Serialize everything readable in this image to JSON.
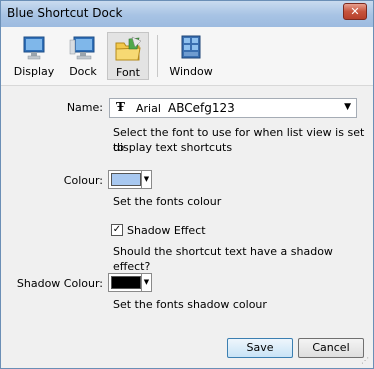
{
  "window": {
    "title": "Blue Shortcut Dock",
    "close_label": "✕"
  },
  "toolbar": {
    "items": [
      {
        "label": "Display",
        "icon": "monitor-icon"
      },
      {
        "label": "Dock",
        "icon": "monitor-dock-icon"
      },
      {
        "label": "Font",
        "icon": "folder-font-icon",
        "active": true
      },
      {
        "label": "Window",
        "icon": "window-grid-icon"
      }
    ]
  },
  "name": {
    "label": "Name:",
    "font_icon": "Ŧ",
    "font_name": "Arial",
    "sample": "ABCefg123",
    "description_line1": "Select the font to use for when list view is set to",
    "description_line2": "display text shortcuts"
  },
  "colour": {
    "label": "Colour:",
    "swatch_color": "#a8c8f0",
    "description": "Set the fonts colour"
  },
  "shadow_effect": {
    "checked": true,
    "label": "Shadow Effect",
    "description": "Should the shortcut text have a shadow effect?"
  },
  "shadow_colour": {
    "label": "Shadow Colour:",
    "swatch_color": "#000000",
    "description": "Set the fonts shadow colour"
  },
  "buttons": {
    "save": "Save",
    "cancel": "Cancel"
  }
}
